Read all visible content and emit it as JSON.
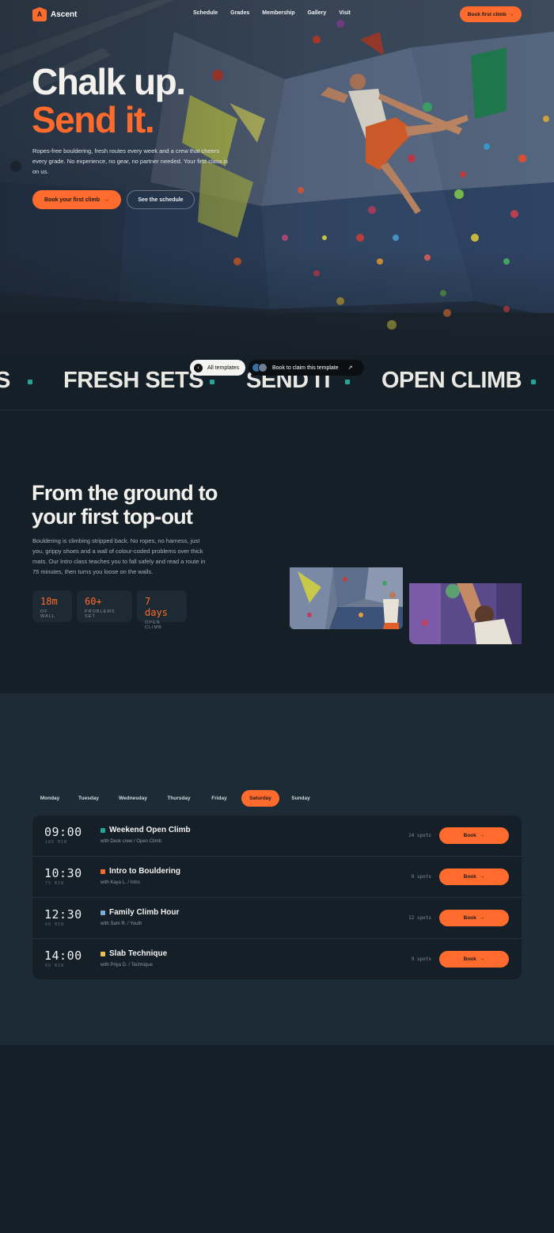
{
  "nav": {
    "logo_letter": "A",
    "brand": "Ascent",
    "links": [
      "Schedule",
      "Grades",
      "Membership",
      "Gallery",
      "Visit"
    ],
    "cta": "Book first climb"
  },
  "hero": {
    "headline_1": "Chalk up.",
    "headline_2": "Send it.",
    "description": "Ropes-free bouldering, fresh routes every week and a crew that cheers every grade. No experience, no gear, no partner needed. Your first class is on us.",
    "primary_button": "Book your first climb",
    "secondary_button": "See the schedule"
  },
  "marquee": {
    "items": [
      "S",
      "FRESH SETS",
      "SEND IT",
      "OPEN CLIMB"
    ]
  },
  "overlay": {
    "all_templates": "All templates",
    "book_template": "Book to claim this template"
  },
  "intro": {
    "title": "From the ground to your first top-out",
    "body": "Bouldering is climbing stripped back. No ropes, no harness, just you, grippy shoes and a wall of colour-coded problems over thick mats. Our Intro class teaches you to fall safely and read a route in 75 minutes, then turns you loose on the walls.",
    "stats": [
      {
        "value": "18m",
        "label": "OF WALL"
      },
      {
        "value": "60+",
        "label": "PROBLEMS SET"
      },
      {
        "value": "7 days",
        "label": "OPEN CLIMB"
      }
    ]
  },
  "schedule": {
    "days": [
      "Monday",
      "Tuesday",
      "Wednesday",
      "Thursday",
      "Friday",
      "Saturday",
      "Sunday"
    ],
    "active_day": "Saturday",
    "sessions": [
      {
        "time": "09:00",
        "duration": "180 MIN",
        "name": "Weekend Open Climb",
        "meta": "with Desk crew / Open Climb",
        "spots": "24 spots",
        "color": "#23a59a",
        "button": "Book"
      },
      {
        "time": "10:30",
        "duration": "75 MIN",
        "name": "Intro to Bouldering",
        "meta": "with Kaya L. / Intro",
        "spots": "8 spots",
        "color": "#ff6b2c",
        "button": "Book"
      },
      {
        "time": "12:30",
        "duration": "60 MIN",
        "name": "Family Climb Hour",
        "meta": "with Sam R. / Youth",
        "spots": "12 spots",
        "color": "#7aaee0",
        "button": "Book"
      },
      {
        "time": "14:00",
        "duration": "60 MIN",
        "name": "Slab Technique",
        "meta": "with Priya D. / Technique",
        "spots": "9 spots",
        "color": "#f2c14e",
        "button": "Book"
      }
    ]
  },
  "colors": {
    "accent": "#ff6b2c",
    "teal": "#23a59a",
    "background": "#151f27",
    "panel": "#1c2b35"
  }
}
